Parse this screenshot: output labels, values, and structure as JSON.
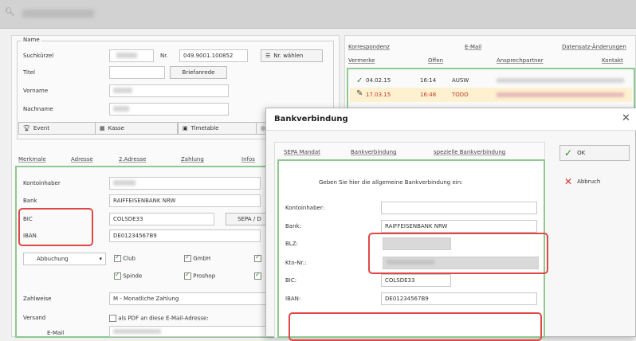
{
  "left": {
    "name_group": "Name",
    "suchkuerzel_label": "Suchkürzel",
    "nr_label": "Nr.",
    "nr_value": "049.9001.100852",
    "nr_waehlen": "Nr. wählen",
    "titel_label": "Titel",
    "briefanrede": "Briefanrede",
    "vorname_label": "Vorname",
    "nachname_label": "Nachname",
    "event_btn": "Event",
    "kasse_btn": "Kasse",
    "timetable_btn": "Timetable",
    "tabs": [
      "Merkmale",
      "Adresse",
      "2.Adresse",
      "Zahlung",
      "Infos"
    ],
    "kontoinhaber_label": "Kontoinhaber",
    "bank_label": "Bank",
    "bank_value": "RAIFFEISENBANK NRW",
    "bic_label": "BIC",
    "bic_value": "COLSDE33",
    "iban_label": "IBAN",
    "iban_value": "DE01234567B9",
    "sepa_btn": "SEPA / D",
    "abbuchung": "Abbuchung",
    "club": "Club",
    "gmbh": "GmbH",
    "spinde": "Spinde",
    "proshop": "Proshop",
    "zahlweise_label": "Zahlweise",
    "zahlweise_value": "M - Monatliche Zahlung",
    "versand_label": "Versand",
    "versand_option": "als PDF an diese E-Mail-Adresse:",
    "email_label": "E-Mail"
  },
  "right": {
    "tabs_row1": [
      "Korrespondenz",
      "E-Mail",
      "Datensatz-Änderungen"
    ],
    "tabs_row2": [
      "Vermerke",
      "Offen",
      "Ansprechpartner",
      "Kontakt"
    ],
    "rows": [
      {
        "date": "04.02.15",
        "time": "16:14",
        "type": "AUSW"
      },
      {
        "date": "17.03.15",
        "time": "16:48",
        "type": "TODO"
      }
    ]
  },
  "dialog": {
    "title": "Bankverbindung",
    "close": "✕",
    "tabs": [
      "SEPA Mandat",
      "Bankverbindung",
      "spezielle Bankverbindung"
    ],
    "instruction": "Geben Sie hier die allgemeine Bankverbindung ein:",
    "kontoinhaber_label": "Kontoinhaber:",
    "bank_label": "Bank:",
    "bank_value": "RAIFFEISENBANK NRW",
    "blz_label": "BLZ:",
    "kto_label": "Kto-Nr.:",
    "bic_label": "BIC:",
    "bic_value": "COLSDE33",
    "iban_label": "IBAN:",
    "iban_value": "DE01234567B9",
    "ok": "OK",
    "abbruch": "Abbruch"
  },
  "colors": {
    "highlight_row": "#fdf1cf",
    "green": "#8fc98f",
    "red": "#e04848",
    "todo": "#c0392b"
  }
}
